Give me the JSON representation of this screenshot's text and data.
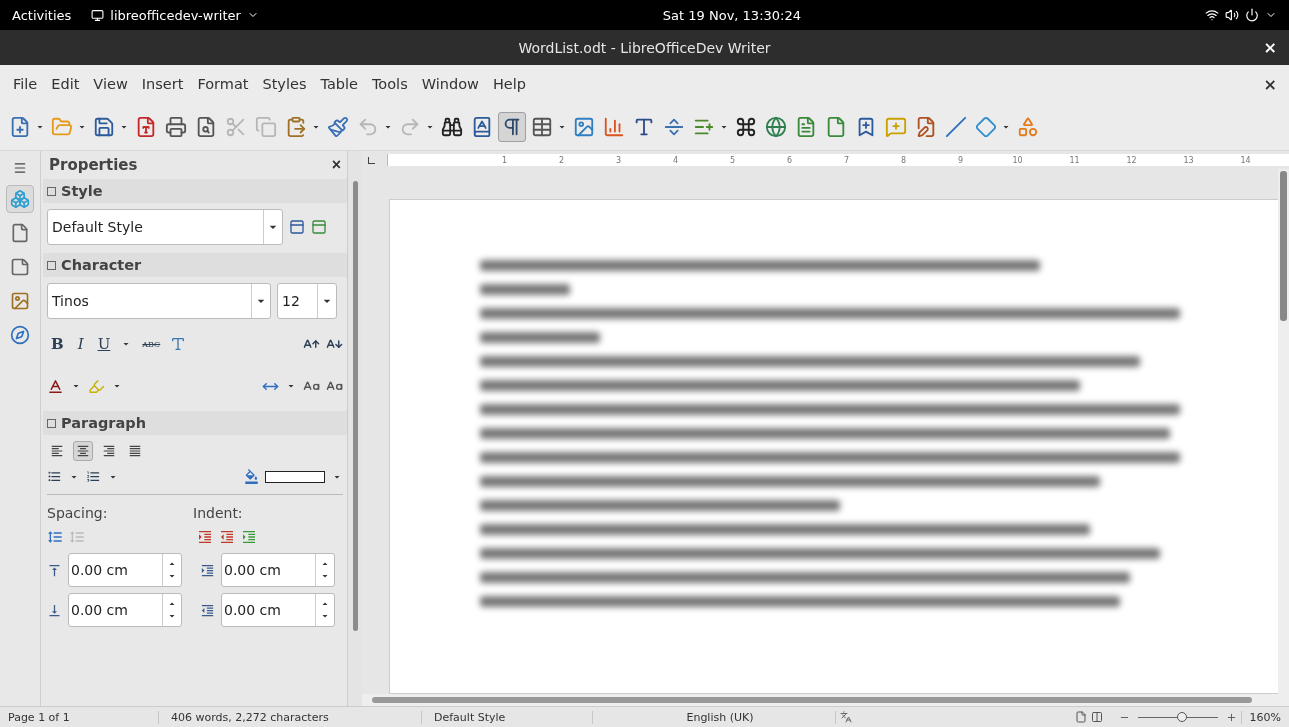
{
  "top_bar": {
    "activities": "Activities",
    "app_menu": "libreofficedev-writer",
    "clock": "Sat 19 Nov, 13:30:24"
  },
  "window": {
    "title": "WordList.odt - LibreOfficeDev Writer",
    "close": "×"
  },
  "menu": {
    "items": [
      "File",
      "Edit",
      "View",
      "Insert",
      "Format",
      "Styles",
      "Table",
      "Tools",
      "Window",
      "Help"
    ],
    "close": "×"
  },
  "toolbar": [
    {
      "kind": "new",
      "dropdown": true,
      "disabled": false,
      "selected": false
    },
    {
      "kind": "open",
      "dropdown": true,
      "disabled": false,
      "selected": false
    },
    {
      "kind": "save",
      "dropdown": true,
      "disabled": false,
      "selected": false
    },
    {
      "kind": "pdf",
      "dropdown": false,
      "disabled": false,
      "selected": false
    },
    {
      "kind": "print",
      "dropdown": false,
      "disabled": false,
      "selected": false
    },
    {
      "kind": "preview",
      "dropdown": false,
      "disabled": false,
      "selected": false
    },
    {
      "kind": "cut",
      "dropdown": false,
      "disabled": true,
      "selected": false
    },
    {
      "kind": "copy",
      "dropdown": false,
      "disabled": true,
      "selected": false
    },
    {
      "kind": "paste",
      "dropdown": true,
      "disabled": false,
      "selected": false
    },
    {
      "kind": "clone",
      "dropdown": false,
      "disabled": false,
      "selected": false
    },
    {
      "kind": "undo",
      "dropdown": true,
      "disabled": true,
      "selected": false
    },
    {
      "kind": "redo",
      "dropdown": true,
      "disabled": true,
      "selected": false
    },
    {
      "kind": "find",
      "dropdown": false,
      "disabled": false,
      "selected": false
    },
    {
      "kind": "spelling",
      "dropdown": false,
      "disabled": false,
      "selected": false
    },
    {
      "kind": "formatting_marks",
      "dropdown": false,
      "disabled": false,
      "selected": true
    },
    {
      "kind": "table",
      "dropdown": true,
      "disabled": false,
      "selected": false
    },
    {
      "kind": "image",
      "dropdown": false,
      "disabled": false,
      "selected": false
    },
    {
      "kind": "chart",
      "dropdown": false,
      "disabled": false,
      "selected": false
    },
    {
      "kind": "textbox",
      "dropdown": false,
      "disabled": false,
      "selected": false
    },
    {
      "kind": "page_break",
      "dropdown": false,
      "disabled": false,
      "selected": false
    },
    {
      "kind": "field",
      "dropdown": true,
      "disabled": false,
      "selected": false
    },
    {
      "kind": "special_char",
      "dropdown": false,
      "disabled": false,
      "selected": false
    },
    {
      "kind": "hyperlink",
      "dropdown": false,
      "disabled": false,
      "selected": false
    },
    {
      "kind": "footnote",
      "dropdown": false,
      "disabled": false,
      "selected": false
    },
    {
      "kind": "endnote",
      "dropdown": false,
      "disabled": false,
      "selected": false
    },
    {
      "kind": "bookmark",
      "dropdown": false,
      "disabled": false,
      "selected": false
    },
    {
      "kind": "comment",
      "dropdown": false,
      "disabled": false,
      "selected": false
    },
    {
      "kind": "track_changes",
      "dropdown": false,
      "disabled": false,
      "selected": false
    },
    {
      "kind": "line",
      "dropdown": false,
      "disabled": false,
      "selected": false
    },
    {
      "kind": "shape",
      "dropdown": true,
      "disabled": false,
      "selected": false
    },
    {
      "kind": "draw",
      "dropdown": false,
      "disabled": false,
      "selected": false
    }
  ],
  "sidebar_tabs": [
    {
      "kind": "menu",
      "selected": false
    },
    {
      "kind": "properties",
      "selected": true
    },
    {
      "kind": "page",
      "selected": false
    },
    {
      "kind": "styles",
      "selected": false
    },
    {
      "kind": "gallery",
      "selected": false
    },
    {
      "kind": "navigator",
      "selected": false
    }
  ],
  "properties": {
    "title": "Properties",
    "close": "×",
    "style": {
      "heading": "Style",
      "value": "Default Style"
    },
    "character": {
      "heading": "Character",
      "font": "Tinos",
      "size": "12",
      "format_buttons": [
        {
          "label": "B",
          "kind": "bold"
        },
        {
          "label": "I",
          "kind": "italic"
        },
        {
          "label": "U",
          "kind": "underline"
        },
        {
          "label": "ABC",
          "kind": "strike"
        }
      ]
    },
    "paragraph": {
      "heading": "Paragraph",
      "alignment": [
        {
          "kind": "left",
          "selected": false
        },
        {
          "kind": "center",
          "selected": true
        },
        {
          "kind": "right",
          "selected": false
        },
        {
          "kind": "justify",
          "selected": false
        }
      ],
      "spacing_label": "Spacing:",
      "indent_label": "Indent:",
      "fields": [
        {
          "kind": "above",
          "value": "0.00 cm"
        },
        {
          "kind": "before",
          "value": "0.00 cm"
        },
        {
          "kind": "below",
          "value": "0.00 cm"
        },
        {
          "kind": "after",
          "value": "0.00 cm"
        }
      ]
    }
  },
  "ruler": {
    "marks": [
      "1",
      "2",
      "3",
      "4",
      "5",
      "6",
      "7",
      "8",
      "9",
      "10",
      "11",
      "12",
      "13",
      "14"
    ]
  },
  "status_bar": {
    "page": "Page 1 of 1",
    "count": "406 words, 2,272 characters",
    "style": "Default Style",
    "language": "English (UK)",
    "zoom_slider": {
      "level": 0.55
    },
    "zoom": "160%"
  }
}
